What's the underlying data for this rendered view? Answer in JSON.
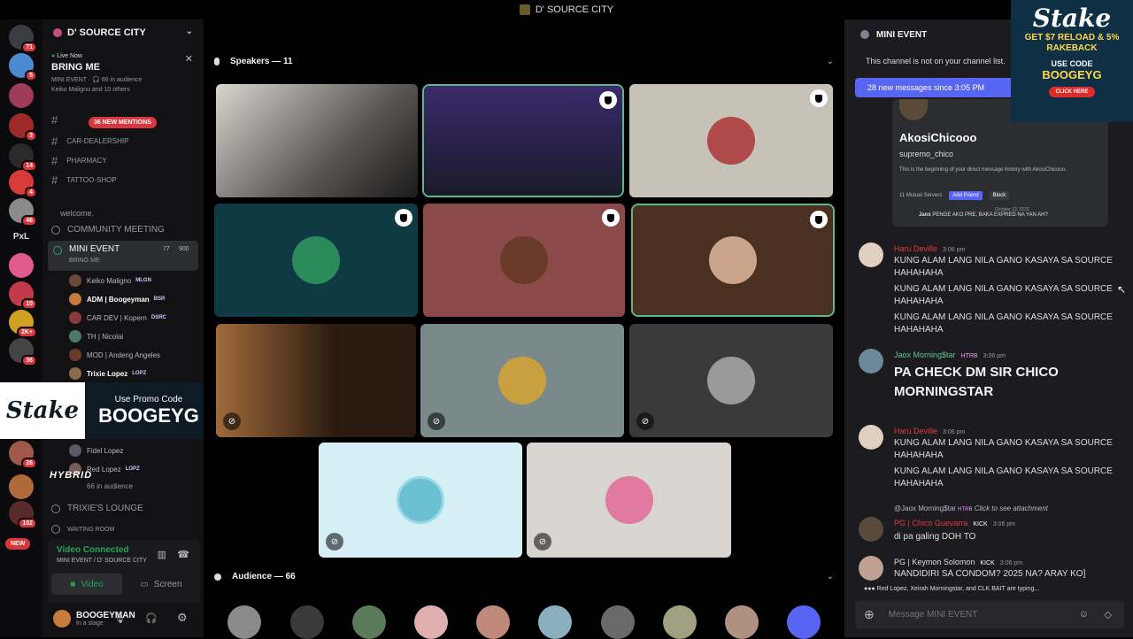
{
  "window": {
    "title": "D' SOURCE CITY"
  },
  "rail": {
    "badges": [
      "71",
      "5",
      "3",
      "14",
      "4",
      "46",
      "10",
      "2K+",
      "36",
      "26",
      "102"
    ],
    "pxl": "PxL",
    "new_label": "NEW"
  },
  "server": {
    "name": "D' SOURCE CITY"
  },
  "live": {
    "status": "Live Now",
    "title": "BRING ME",
    "audience_line": "MINI EVENT · 🎧 66 in audience",
    "speakers_line": "Keiko Maligno and 10 others"
  },
  "mentions_label": "36 NEW MENTIONS",
  "channels": [
    "CAR-DEALERSHIP",
    "PHARMACY",
    "TATTOO-SHOP"
  ],
  "welcome": "welcome.",
  "voice_channels": {
    "community": "COMMUNITY MEETING",
    "mini_event": "MINI EVENT",
    "mini_event_sub": "BRING ME",
    "mini_event_count_a": "77",
    "mini_event_count_b": "900",
    "trixie": "TRIXIE'S LOUNGE",
    "waiting": "WAITING ROOM"
  },
  "members": [
    {
      "name": "Keiko Maligno",
      "tag": "MLGN"
    },
    {
      "name": "ADM | Boogeyman",
      "tag": "BSR"
    },
    {
      "name": "CAR DEV | Kopern",
      "tag": "DSRC"
    },
    {
      "name": "TH | Nicolai",
      "tag": ""
    },
    {
      "name": "MOD | Andeng Angeles",
      "tag": ""
    },
    {
      "name": "Trixie Lopez",
      "tag": "LOPZ"
    },
    {
      "name": "Fidel Lopez",
      "tag": ""
    },
    {
      "name": "Red Lopez",
      "tag": "LOPZ"
    }
  ],
  "in_audience": "66 in audience",
  "promo": {
    "line1": "Use Promo Code",
    "code": "BOOGEYG",
    "brand": "Stake"
  },
  "hybrid": "HYBRID",
  "connection": {
    "status": "Video Connected",
    "sub": "MINI EVENT / D' SOURCE CITY",
    "video": "Video",
    "screen": "Screen"
  },
  "user": {
    "name": "BOOGEYMAN",
    "status": "In a stage"
  },
  "stage": {
    "speakers_header": "Speakers — 11",
    "audience_header": "Audience — 66"
  },
  "chat": {
    "channel": "MINI EVENT",
    "notice": "This channel is not on your channel list.",
    "new_messages": "28 new messages since 3:05 PM",
    "attachment": {
      "name": "AkosiChicooo",
      "handle": "supremo_chico",
      "desc": "This is the beginning of your direct message history with AkosiChicooo.",
      "servers": "11 Mutual Servers",
      "add": "Add Friend",
      "block": "Block",
      "date": "October 19, 2025",
      "sender": "Jaox",
      "message": "PENGE AKO PRE, BAKA EXPRED NA YAN AH?"
    },
    "messages": [
      {
        "author": "Haru Deville",
        "time": "3:06 pm",
        "lines": [
          "KUNG ALAM LANG NILA GANO KASAYA SA SOURCE HAHAHAHA",
          "KUNG ALAM LANG NILA GANO KASAYA SA SOURCE HAHAHAHA",
          "KUNG ALAM LANG NILA GANO KASAYA SA SOURCE HAHAHAHA"
        ]
      },
      {
        "author": "Jaox Morning$tar",
        "tag": "HTRB",
        "time": "3:06 pm",
        "lines": [
          "PA CHECK DM SIR CHICO MORNINGSTAR"
        ]
      },
      {
        "author": "Haru Deville",
        "time": "3:06 pm",
        "lines": [
          "KUNG ALAM LANG NILA GANO KASAYA SA SOURCE HAHAHAHA",
          "KUNG ALAM LANG NILA GANO KASAYA SA SOURCE HAHAHAHA"
        ]
      },
      {
        "author": "PG | Chico Guevarra",
        "tag": "KICK",
        "time": "3:06 pm",
        "reply": "@Jaox Morning$tar",
        "reply_tag": "HTRB",
        "reply_text": "Click to see attachment",
        "lines": [
          "di pa galing DOH TO"
        ]
      },
      {
        "author": "PG | Keymon Solomon",
        "tag": "KICK",
        "time": "3:06 pm",
        "lines": [
          "NANDIDIRI SA CONDOM? 2025 NA? ARAY KO]"
        ]
      }
    ],
    "typing": "Red Lopez, Xeirah Morningstar, and CLK BAIT are typing...",
    "placeholder": "Message MINI EVENT"
  },
  "ad": {
    "brand": "Stake",
    "offer": "GET $7 RELOAD & 5% RAKEBACK",
    "use_code": "USE CODE",
    "code": "BOOGEYG",
    "cta": "CLICK HERE"
  }
}
